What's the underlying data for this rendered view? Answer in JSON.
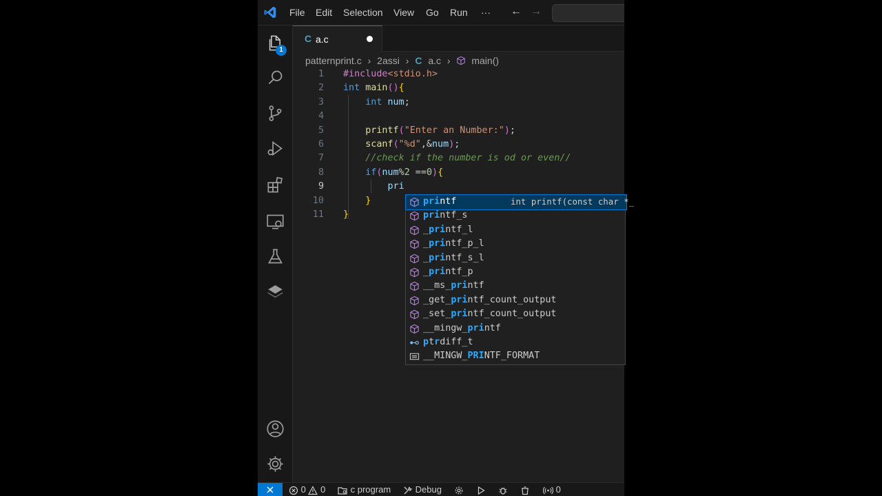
{
  "menu": [
    "File",
    "Edit",
    "Selection",
    "View",
    "Go",
    "Run",
    "···"
  ],
  "nav": {
    "back": "←",
    "forward": "→"
  },
  "activity": {
    "explorer_badge": "1",
    "icons": [
      "files-icon",
      "search-icon",
      "source-control-icon",
      "run-debug-icon",
      "extensions-icon",
      "remote-explorer-icon",
      "testing-icon",
      "layers-icon",
      "account-icon",
      "settings-gear-icon"
    ]
  },
  "tab": {
    "icon": "C",
    "label": "a.c"
  },
  "breadcrumb": {
    "folder1": "patternprint.c",
    "folder2": "2assi",
    "file_icon": "C",
    "file": "a.c",
    "symbol": "main()"
  },
  "editor": {
    "line_numbers": [
      "1",
      "2",
      "3",
      "4",
      "5",
      "6",
      "7",
      "8",
      "9",
      "10",
      "11"
    ],
    "active_line": 9,
    "lines": [
      "#include<stdio.h>",
      "int main(){",
      "    int num;",
      "",
      "    printf(\"Enter an Number:\");",
      "    scanf(\"%d\",&num);",
      "    //check if the number is od or even//",
      "    if(num%2 ==0){",
      "        pri",
      "    }",
      "}"
    ]
  },
  "suggest": {
    "selected_detail": "int printf(const char *_",
    "items": [
      {
        "pre": "",
        "hl": "pri",
        "post": "ntf",
        "kind": "method"
      },
      {
        "pre": "",
        "hl": "pri",
        "post": "ntf_s",
        "kind": "method"
      },
      {
        "pre": "_",
        "hl": "pri",
        "post": "ntf_l",
        "kind": "method"
      },
      {
        "pre": "_",
        "hl": "pri",
        "post": "ntf_p_l",
        "kind": "method"
      },
      {
        "pre": "_",
        "hl": "pri",
        "post": "ntf_s_l",
        "kind": "method"
      },
      {
        "pre": "_",
        "hl": "pri",
        "post": "ntf_p",
        "kind": "method"
      },
      {
        "pre": "__ms_",
        "hl": "pri",
        "post": "ntf",
        "kind": "method"
      },
      {
        "pre": "_get_",
        "hl": "pri",
        "post": "ntf_count_output",
        "kind": "method"
      },
      {
        "pre": "_set_",
        "hl": "pri",
        "post": "ntf_count_output",
        "kind": "method"
      },
      {
        "pre": "__mingw_",
        "hl": "pri",
        "post": "ntf",
        "kind": "method"
      },
      {
        "pre": "",
        "hl": "p",
        "mid": "t",
        "hl2": "r",
        "post": "diff_t",
        "kind": "typedef"
      },
      {
        "pre": "__MINGW_",
        "hl": "PRI",
        "post": "NTF_FORMAT",
        "kind": "constant"
      }
    ]
  },
  "statusbar": {
    "errors": "0",
    "warnings": "0",
    "config": "c program",
    "debug": "Debug",
    "ports": "0"
  },
  "colors": {
    "accent": "#0078d4",
    "background": "#1f1f1f",
    "sidebar": "#181818"
  }
}
